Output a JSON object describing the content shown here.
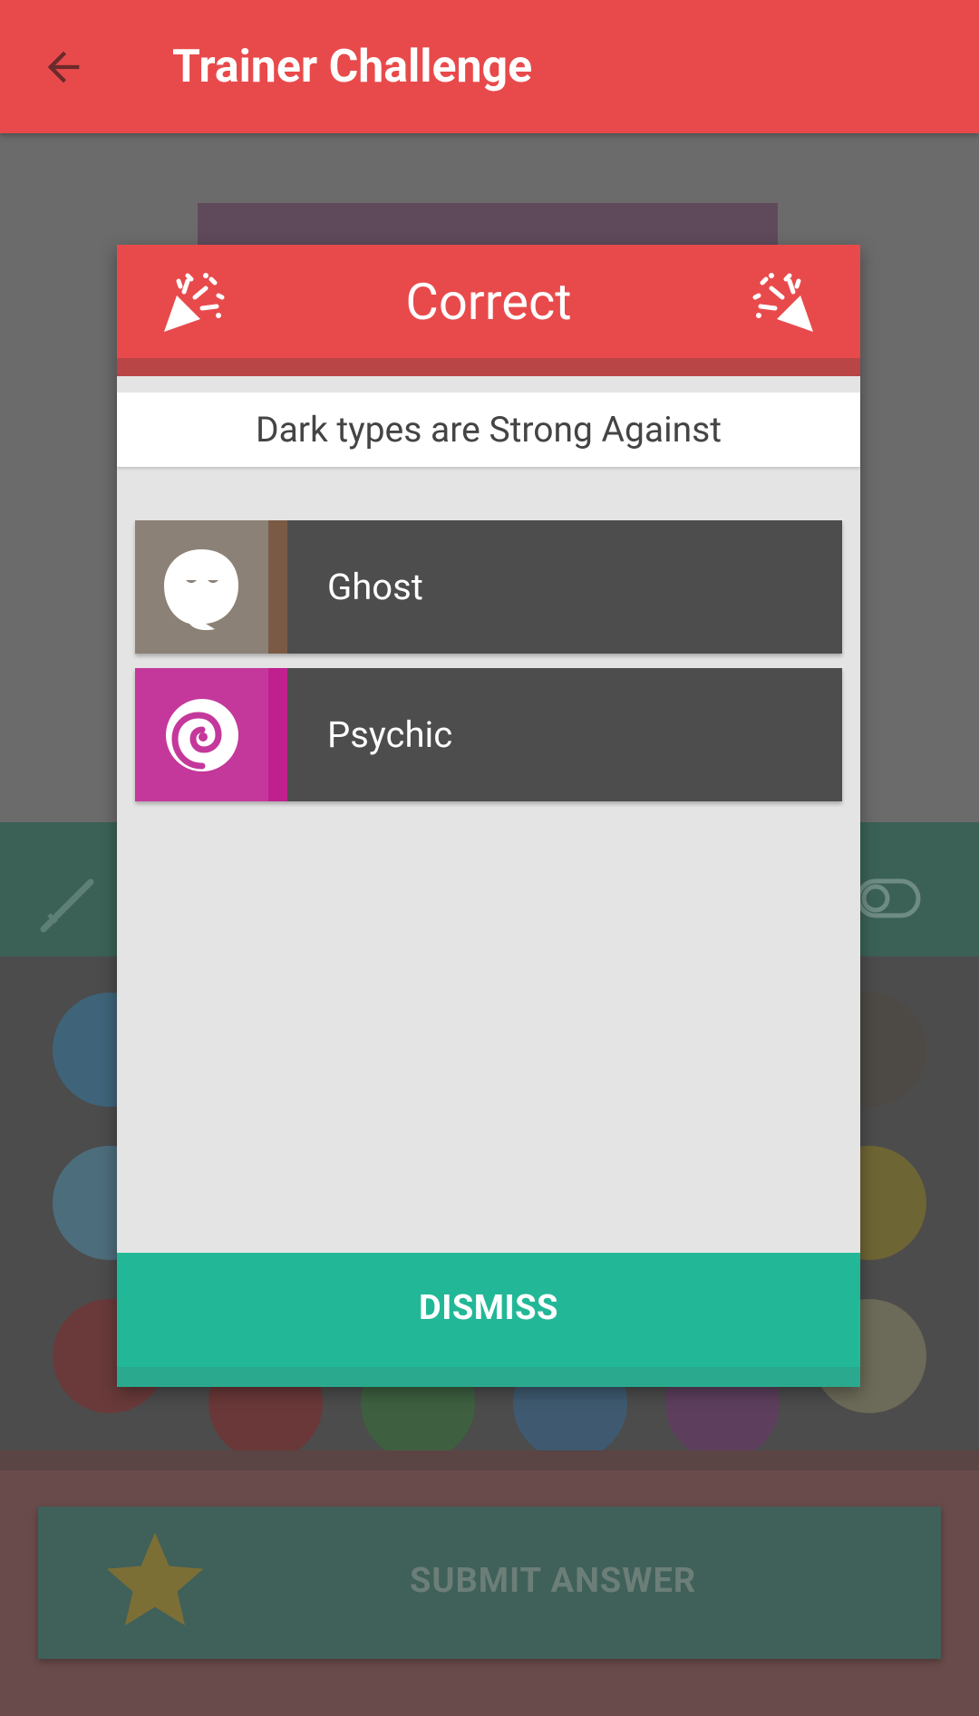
{
  "app_bar": {
    "title": "Trainer Challenge"
  },
  "dialog": {
    "title": "Correct",
    "subtitle": "Dark types are Strong Against",
    "types": [
      {
        "label": "Ghost",
        "icon": "ghost-icon",
        "icon_bg": "#8c8176",
        "accent": "#7a5a45"
      },
      {
        "label": "Psychic",
        "icon": "psychic-swirl-icon",
        "icon_bg": "#c4389b",
        "accent": "#c0208e"
      }
    ],
    "dismiss_label": "DISMISS"
  },
  "background": {
    "submit_label": "SUBMIT ANSWER"
  },
  "colors": {
    "primary": "#e84a4b",
    "accent": "#22b897",
    "row": "#4d4d4d"
  }
}
